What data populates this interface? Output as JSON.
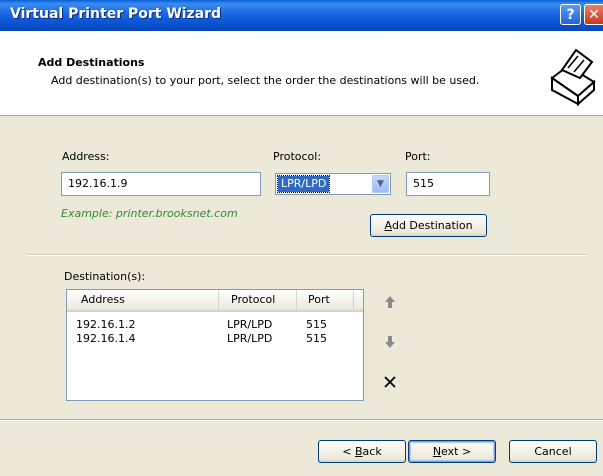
{
  "window": {
    "title": "Virtual Printer Port Wizard",
    "help_glyph": "?",
    "close_glyph": "✕"
  },
  "header": {
    "title": "Add Destinations",
    "subtitle": "Add destination(s) to your port, select the order the destinations will be used."
  },
  "form": {
    "address_label": "Address:",
    "address_value": "192.16.1.9",
    "protocol_label": "Protocol:",
    "protocol_value": "LPR/LPD",
    "port_label": "Port:",
    "port_value": "515",
    "example_text": "Example: printer.brooksnet.com",
    "add_button": {
      "mnemonic": "A",
      "rest": "dd Destination"
    }
  },
  "destinations": {
    "label": "Destination(s):",
    "columns": [
      "Address",
      "Protocol",
      "Port"
    ],
    "rows": [
      {
        "address": "192.16.1.2",
        "protocol": "LPR/LPD",
        "port": "515"
      },
      {
        "address": "192.16.1.4",
        "protocol": "LPR/LPD",
        "port": "515"
      }
    ]
  },
  "footer": {
    "back_button": {
      "prefix": "< ",
      "mnemonic": "B",
      "rest": "ack"
    },
    "next_button": {
      "mnemonic": "N",
      "rest": "ext >"
    },
    "cancel_button": "Cancel"
  },
  "colors": {
    "titlebar": "#0c56d6",
    "dialog_bg": "#ece9d8",
    "example_text": "#2e8b3a",
    "selection": "#316ac5"
  },
  "icons": {
    "header": "printer-port-icon",
    "move_up": "arrow-up-icon",
    "move_down": "arrow-down-icon",
    "delete": "delete-x-icon"
  }
}
